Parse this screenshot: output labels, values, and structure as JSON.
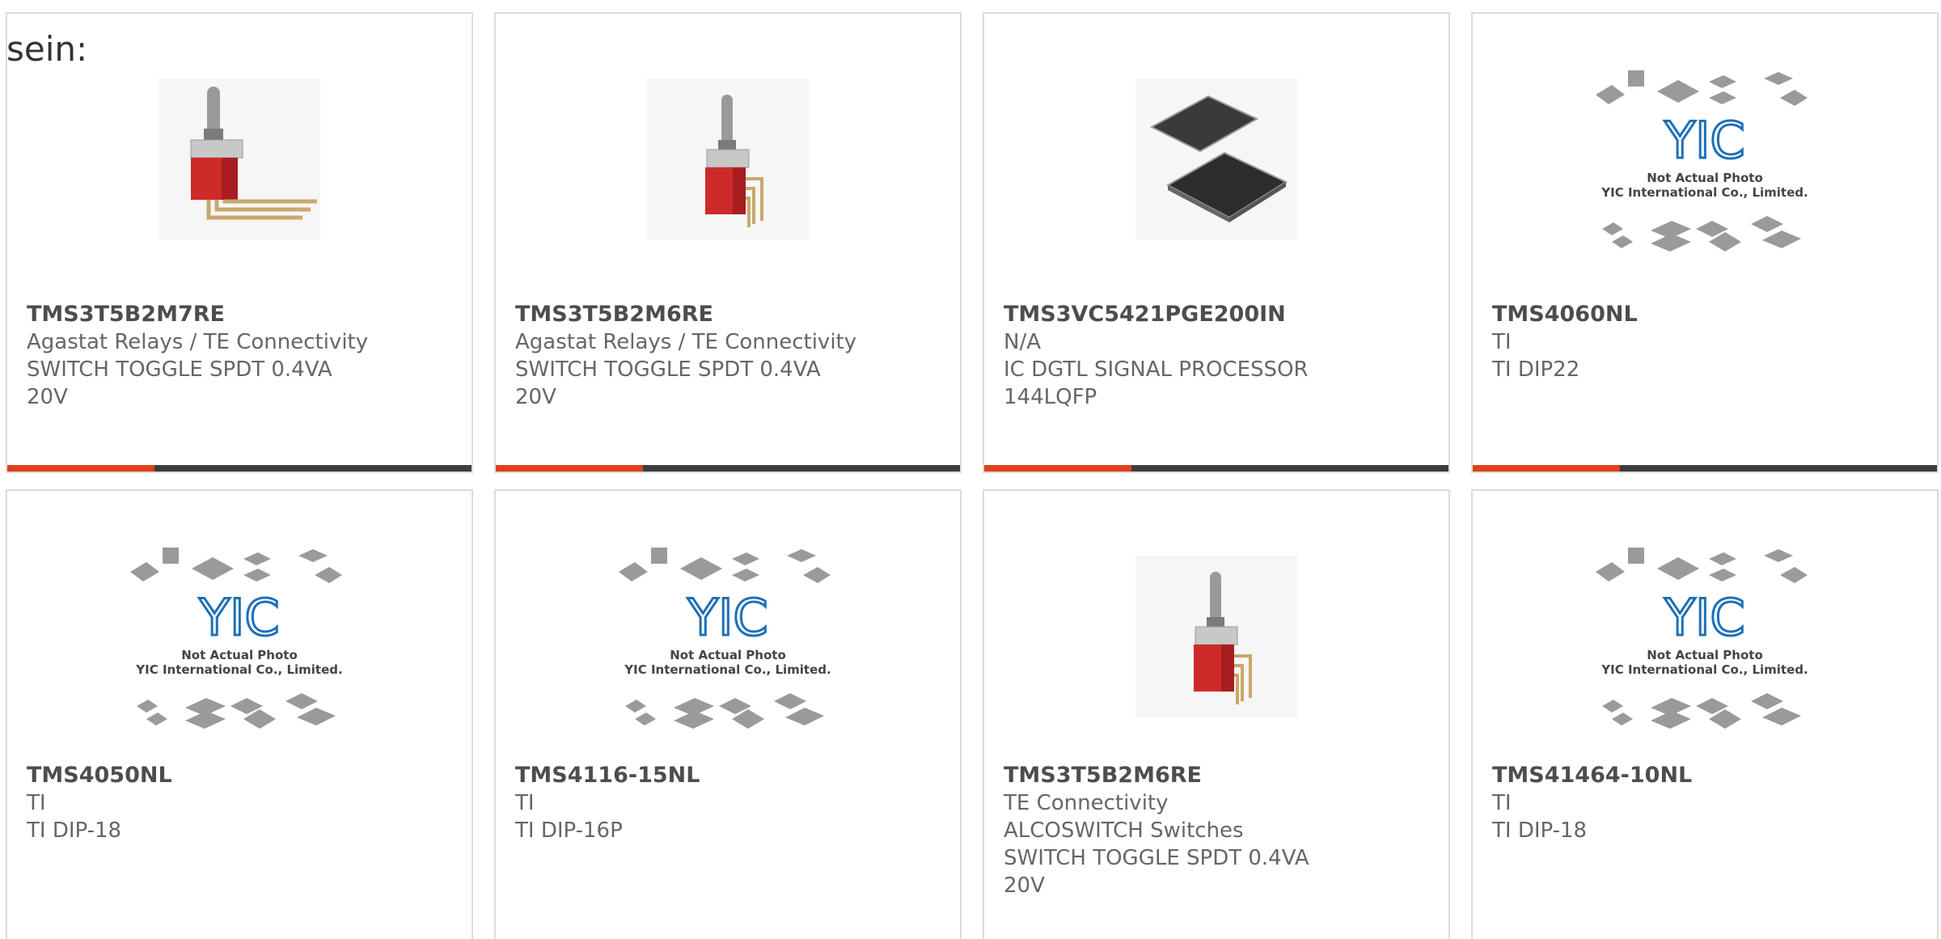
{
  "intro": "sein:",
  "accent_color": "#e0401a",
  "bar_color": "#3d3d3d",
  "products": [
    {
      "part": "TMS3T5B2M7RE",
      "manufacturer": "Agastat Relays / TE Connectivity",
      "desc1": "SWITCH TOGGLE SPDT 0.4VA",
      "desc2": "20V",
      "image": "toggle-switch-right-angle"
    },
    {
      "part": "TMS3T5B2M6RE",
      "manufacturer": "Agastat Relays / TE Connectivity",
      "desc1": "SWITCH TOGGLE SPDT 0.4VA",
      "desc2": "20V",
      "image": "toggle-switch"
    },
    {
      "part": "TMS3VC5421PGE200IN",
      "manufacturer": "N/A",
      "desc1": "IC DGTL SIGNAL PROCESSOR",
      "desc2": "144LQFP",
      "image": "lqfp-chip"
    },
    {
      "part": "TMS4060NL",
      "manufacturer": "TI",
      "desc1": "TI DIP22",
      "desc2": "",
      "image": "not-actual-photo",
      "placeholder_line1": "Not Actual Photo",
      "placeholder_line2": "YIC International Co., Limited.",
      "placeholder_logo": "YIC"
    },
    {
      "part": "TMS4050NL",
      "manufacturer": "TI",
      "desc1": "TI DIP-18",
      "desc2": "",
      "image": "not-actual-photo",
      "placeholder_line1": "Not Actual Photo",
      "placeholder_line2": "YIC International Co., Limited.",
      "placeholder_logo": "YIC"
    },
    {
      "part": "TMS4116-15NL",
      "manufacturer": "TI",
      "desc1": "TI DIP-16P",
      "desc2": "",
      "image": "not-actual-photo",
      "placeholder_line1": "Not Actual Photo",
      "placeholder_line2": "YIC International Co., Limited.",
      "placeholder_logo": "YIC"
    },
    {
      "part": "TMS3T5B2M6RE",
      "manufacturer": "TE Connectivity ALCOSWITCH Switches",
      "desc1": "SWITCH TOGGLE SPDT 0.4VA",
      "desc2": "20V",
      "image": "toggle-switch"
    },
    {
      "part": "TMS41464-10NL",
      "manufacturer": "TI",
      "desc1": "TI DIP-18",
      "desc2": "",
      "image": "not-actual-photo",
      "placeholder_line1": "Not Actual Photo",
      "placeholder_line2": "YIC International Co., Limited.",
      "placeholder_logo": "YIC"
    }
  ]
}
